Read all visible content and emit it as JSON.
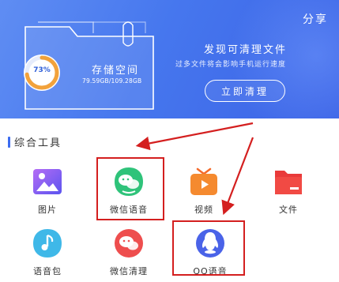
{
  "header": {
    "share_label": "分享",
    "storage": {
      "percent_label": "73%",
      "percent_value": 73,
      "title": "存储空间",
      "usage_text": "79.59GB/109.28GB"
    },
    "promo": {
      "title": "发现可清理文件",
      "subtitle": "过多文件将会影响手机运行速度",
      "button_label": "立即清理"
    }
  },
  "tools_section": {
    "title": "综合工具",
    "items": [
      {
        "label": "图片",
        "icon": "image-gallery-icon"
      },
      {
        "label": "微信语音",
        "icon": "wechat-voice-icon"
      },
      {
        "label": "视频",
        "icon": "video-tv-icon"
      },
      {
        "label": "文件",
        "icon": "folder-file-icon"
      },
      {
        "label": "语音包",
        "icon": "voice-package-icon"
      },
      {
        "label": "微信清理",
        "icon": "wechat-clean-icon"
      },
      {
        "label": "QQ语音",
        "icon": "qq-voice-icon"
      }
    ]
  },
  "colors": {
    "banner": "#4677ee",
    "highlight": "#d41f1f",
    "accent_bar": "#3c6cf0"
  }
}
